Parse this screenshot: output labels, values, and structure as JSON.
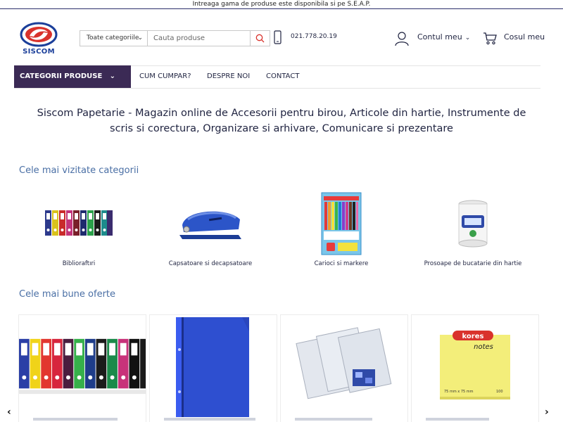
{
  "topbar": {
    "text": "Intreaga gama de produse este disponibila si pe S.E.A.P."
  },
  "header": {
    "logo_text": "SISCOM",
    "category_select": "Toate categoriile",
    "search_placeholder": "Cauta produse",
    "phone": "021.778.20.19",
    "account_label": "Contul meu",
    "cart_label": "Cosul meu"
  },
  "nav": {
    "categories_button": "CATEGORII PRODUSE",
    "links": [
      "CUM CUMPAR?",
      "DESPRE NOI",
      "CONTACT"
    ]
  },
  "hero": {
    "line1": "Siscom Papetarie - Magazin online de Accesorii pentru birou, Articole din hartie, Instrumente de",
    "line2": "scris si corectura, Organizare si arhivare, Comunicare si prezentare"
  },
  "sections": {
    "popular_title": "Cele mai vizitate categorii",
    "offers_title": "Cele mai bune oferte"
  },
  "popular_categories": [
    {
      "name": "Biblioraftıri",
      "icon": "binders-image"
    },
    {
      "name": "Capsatoare si decapsatoare",
      "icon": "stapler-image"
    },
    {
      "name": "Carioci si markere",
      "icon": "markers-image"
    },
    {
      "name": "Prosoape de bucatarie din hartie",
      "icon": "paper-towel-image"
    }
  ],
  "offers": [
    {
      "icon": "binders-offer-image"
    },
    {
      "icon": "folder-offer-image"
    },
    {
      "icon": "sheet-protectors-image"
    },
    {
      "icon": "sticky-notes-image",
      "brand": "kores",
      "product": "notes",
      "size": "75 mm x 75 mm",
      "count": "100"
    }
  ],
  "colors": {
    "nav_purple": "#3b2a55",
    "section_title_blue": "#4a6fa5",
    "text_dark": "#1f2340",
    "search_icon_red": "#d9322c"
  },
  "carousel": {
    "prev": "‹",
    "next": "›"
  }
}
